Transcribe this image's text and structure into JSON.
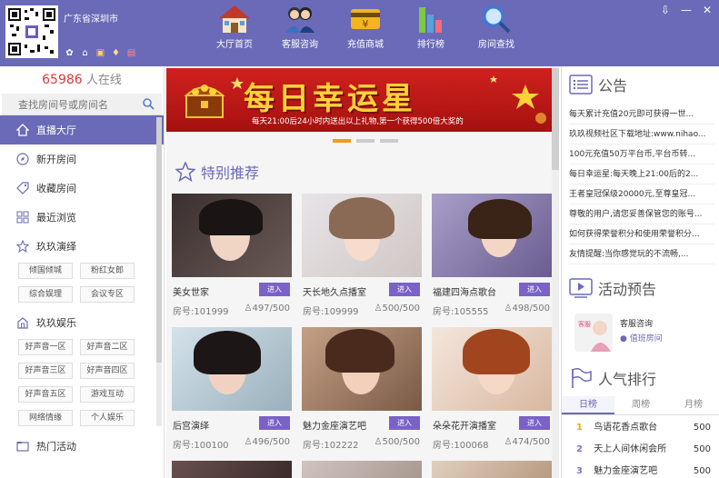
{
  "header": {
    "location": "广东省深圳市",
    "nav": [
      {
        "label": "大厅首页",
        "icon": "house-icon"
      },
      {
        "label": "客服咨询",
        "icon": "support-agents-icon"
      },
      {
        "label": "充值商城",
        "icon": "yen-card-icon"
      },
      {
        "label": "排行榜",
        "icon": "bar-chart-icon"
      },
      {
        "label": "房间查找",
        "icon": "magnifier-icon"
      }
    ],
    "mini_icons": [
      "gear-icon",
      "home-icon",
      "gift-icon",
      "money-bag-icon",
      "calendar-icon"
    ],
    "window_controls": {
      "dropdown": "⇩",
      "minimize": "—",
      "close": "✕"
    }
  },
  "sidebar": {
    "online_count": "65986",
    "online_label": "人在线",
    "search_placeholder": "查找房间号或房间名",
    "items": {
      "live_hall": "直播大厅",
      "new_rooms": "新开房间",
      "favorite_rooms": "收藏房间",
      "recent": "最近浏览",
      "jiujiu_show": "玖玖演绎",
      "jiujiu_fun": "玖玖娱乐",
      "hot_events": "热门活动"
    },
    "show_tags": [
      "倾国倾城",
      "粉红女郎",
      "综合娱理",
      "会议专区"
    ],
    "fun_tags": [
      "好声音一区",
      "好声音二区",
      "好声音三区",
      "好声音四区",
      "好声音五区",
      "游戏互动",
      "网络情缘",
      "个人娱乐"
    ]
  },
  "banner": {
    "title": "每日幸运星",
    "subtitle": "每天21:00后24小时内送出以上礼物,第一个获得500倍大奖的"
  },
  "recommend": {
    "title": "特别推荐",
    "enter_label": "进入",
    "room_prefix": "房号:",
    "cards": [
      {
        "name": "美女世家",
        "room": "101999",
        "count": "497/500"
      },
      {
        "name": "天长地久点播室",
        "room": "109999",
        "count": "500/500"
      },
      {
        "name": "福建四海点歌台",
        "room": "105555",
        "count": "498/500"
      },
      {
        "name": "后宫演绎",
        "room": "100100",
        "count": "496/500"
      },
      {
        "name": "魅力金座演艺吧",
        "room": "102222",
        "count": "500/500"
      },
      {
        "name": "朵朵花开演播室",
        "room": "100068",
        "count": "474/500"
      }
    ]
  },
  "notice": {
    "title": "公告",
    "items": [
      "每天累计充值20元即可获得一世...",
      "玖玖视频社区下载地址:www.nihao...",
      "100元充值50万平台币,平台币转...",
      "每日幸运星:每天晚上21:00后的2...",
      "王者皇冠保级20000元,至尊皇冠...",
      "尊敬的用户,请您妥善保管您的账号...",
      "如何获得荣誉积分和使用荣誉积分...",
      "友情提醒:当你感觉玩的不流畅,..."
    ]
  },
  "activity": {
    "title": "活动预告",
    "name": "客服咨询",
    "status": "值班房间"
  },
  "rank": {
    "title": "人气排行",
    "tabs": [
      "日榜",
      "周榜",
      "月榜"
    ],
    "rows": [
      {
        "rank": "1",
        "name": "鸟语花香点歌台",
        "value": "500"
      },
      {
        "rank": "2",
        "name": "天上人间休闲会所",
        "value": "500"
      },
      {
        "rank": "3",
        "name": "魅力金座演艺吧",
        "value": "500"
      }
    ]
  },
  "colors": {
    "accent": "#6a6ab8",
    "banner_red": "#c81a18",
    "gold": "#ffd23a",
    "count_red": "#d93a3a"
  }
}
